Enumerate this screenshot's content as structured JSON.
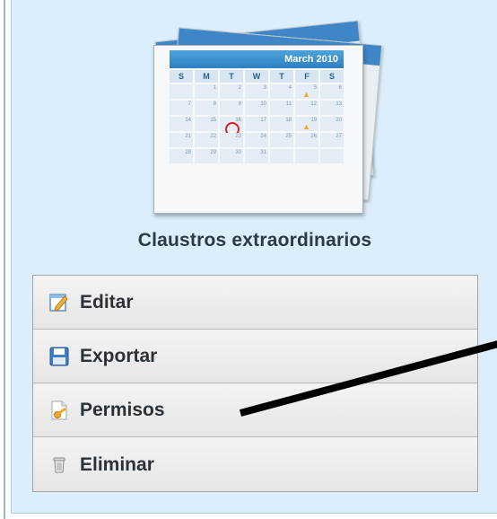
{
  "calendar": {
    "month_label": "March 2010",
    "day_names": [
      "S",
      "M",
      "T",
      "W",
      "T",
      "F",
      "S"
    ],
    "cells": [
      "",
      "1",
      "2",
      "3",
      "4",
      "5",
      "6",
      "7",
      "8",
      "9",
      "10",
      "11",
      "12",
      "13",
      "14",
      "15",
      "16",
      "17",
      "18",
      "19",
      "20",
      "21",
      "22",
      "23",
      "24",
      "25",
      "26",
      "27",
      "28",
      "29",
      "30",
      "31",
      "",
      "",
      ""
    ],
    "marked_day": "16",
    "starred_days": [
      "5",
      "19"
    ]
  },
  "panel": {
    "title": "Claustros extraordinarios"
  },
  "menu": {
    "items": [
      {
        "label": "Editar",
        "icon": "edit-icon"
      },
      {
        "label": "Exportar",
        "icon": "save-icon"
      },
      {
        "label": "Permisos",
        "icon": "permissions-icon"
      },
      {
        "label": "Eliminar",
        "icon": "trash-icon"
      }
    ]
  },
  "colors": {
    "panel_background": "#dceefb",
    "calendar_header": "#3f8dcc",
    "marker_circle": "#e02020",
    "annotation_arrow": "#000000"
  }
}
